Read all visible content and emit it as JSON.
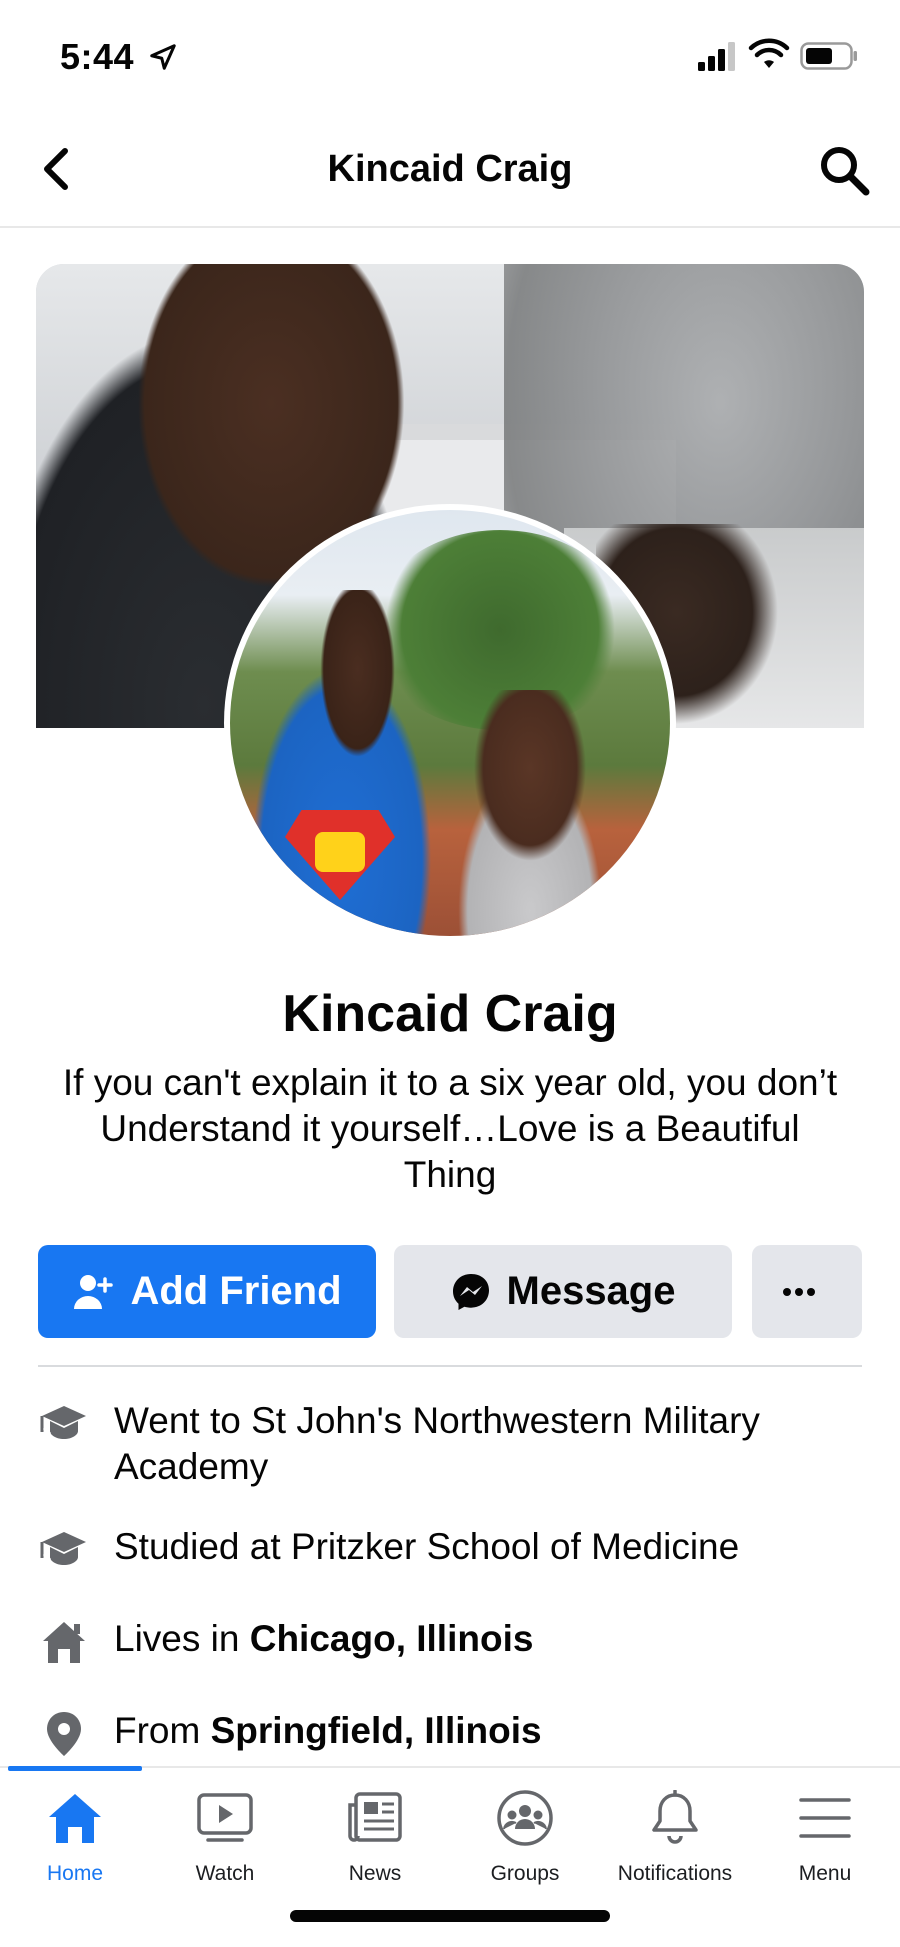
{
  "status": {
    "time": "5:44"
  },
  "header": {
    "title": "Kincaid Craig"
  },
  "profile": {
    "name": "Kincaid Craig",
    "bio": "If you can't explain it to a six year old, you don’t Understand it yourself…Love is a Beautiful Thing"
  },
  "actions": {
    "add_friend": "Add Friend",
    "message": "Message",
    "more": "···"
  },
  "details": [
    {
      "prefix": "Went to St John's Northwestern Military Academy",
      "bold": "",
      "icon": "graduation-cap-icon"
    },
    {
      "prefix": "Studied at Pritzker School of Medicine",
      "bold": "",
      "icon": "graduation-cap-icon"
    },
    {
      "prefix": "Lives in ",
      "bold": "Chicago, Illinois",
      "icon": "home-icon"
    },
    {
      "prefix": "From ",
      "bold": "Springfield, Illinois",
      "icon": "location-pin-icon"
    }
  ],
  "tabs": [
    {
      "label": "Home",
      "icon": "home-icon",
      "active": true
    },
    {
      "label": "Watch",
      "icon": "watch-icon"
    },
    {
      "label": "News",
      "icon": "news-icon"
    },
    {
      "label": "Groups",
      "icon": "groups-icon"
    },
    {
      "label": "Notifications",
      "icon": "bell-icon"
    },
    {
      "label": "Menu",
      "icon": "menu-icon"
    }
  ],
  "colors": {
    "accent": "#1877f2",
    "button_grey": "#e4e6eb",
    "text": "#050505",
    "icon_grey": "#65676b"
  }
}
